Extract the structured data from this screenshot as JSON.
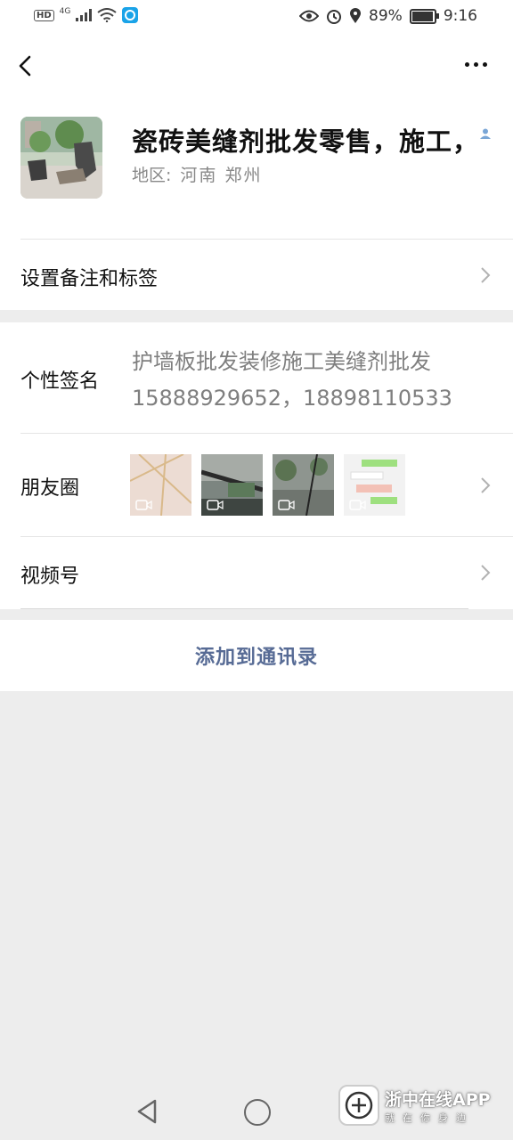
{
  "status_bar": {
    "network": "HD",
    "signal": "4G",
    "battery": "89%",
    "battery_level": 0.89,
    "time": "9:16"
  },
  "profile": {
    "name": "瓷砖美缝剂批发零售，施工，",
    "region_label": "地区:",
    "region_value": "河南 郑州"
  },
  "remark": {
    "label": "设置备注和标签"
  },
  "signature": {
    "label": "个性签名",
    "text": "护墙板批发装修施工美缝剂批发15888929652，18898110533"
  },
  "moments": {
    "label": "朋友圈"
  },
  "channels": {
    "label": "视频号"
  },
  "actions": {
    "add_contact": "添加到通讯录"
  },
  "watermark": {
    "title": "浙中在线APP",
    "subtitle": "就在你身边"
  },
  "colors": {
    "link": "#576b95",
    "background": "#ededed"
  }
}
